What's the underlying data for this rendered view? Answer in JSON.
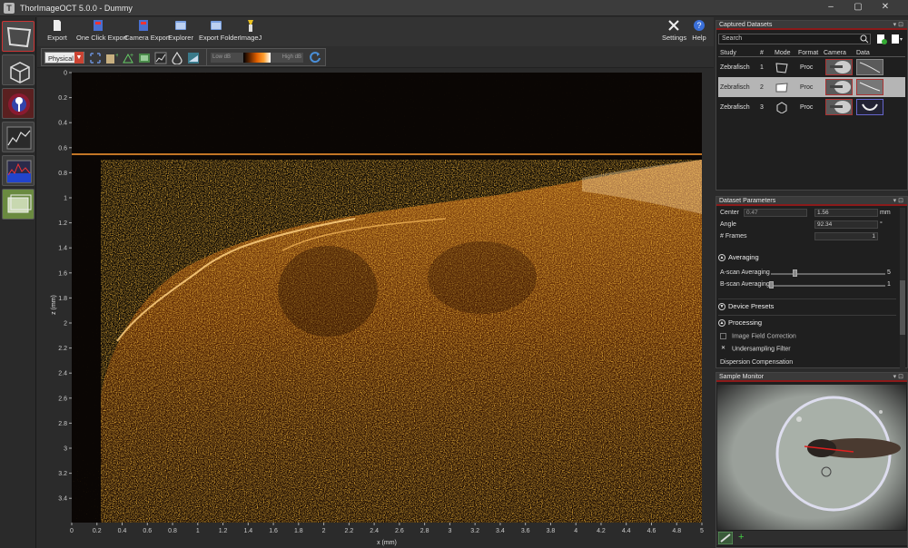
{
  "window": {
    "title": "ThorImageOCT 5.0.0 - Dummy",
    "app_icon_glyph": "T",
    "controls": [
      "–",
      "▢",
      "✕"
    ]
  },
  "toolbar": {
    "export_label": "Export",
    "one_click_export_label": "One Click Export",
    "camera_export_label": "Camera Export",
    "explorer_label": "Explorer",
    "export_folder_label": "Export Folder",
    "imagej_label": "ImageJ",
    "settings_label": "Settings",
    "help_label": "Help"
  },
  "view_toolbar": {
    "view_select_value": "Physical",
    "low_db_label": "Low dB",
    "high_db_label": "High dB"
  },
  "plot": {
    "xlabel": "x (mm)",
    "ylabel": "z (mm)",
    "x_ticks": [
      "0",
      "0.2",
      "0.4",
      "0.6",
      "0.8",
      "1",
      "1.2",
      "1.4",
      "1.6",
      "1.8",
      "2",
      "2.2",
      "2.4",
      "2.6",
      "2.8",
      "3",
      "3.2",
      "3.4",
      "3.6",
      "3.8",
      "4",
      "4.2",
      "4.4",
      "4.6",
      "4.8",
      "5"
    ],
    "y_ticks": [
      "0",
      "0.2",
      "0.4",
      "0.6",
      "0.8",
      "1",
      "1.2",
      "1.4",
      "1.6",
      "1.8",
      "2",
      "2.2",
      "2.4",
      "2.6",
      "2.8",
      "3",
      "3.2",
      "3.4"
    ],
    "colormap": [
      "#000000",
      "#6a2a00",
      "#e06000",
      "#ffa030",
      "#ffffff"
    ]
  },
  "captured_datasets": {
    "title": "Captured Datasets",
    "search_placeholder": "Search",
    "columns": [
      "Study",
      "#",
      "Mode",
      "Format",
      "Camera",
      "Data"
    ],
    "rows": [
      {
        "study": "Zebrafisch",
        "num": "1",
        "format": "Proc",
        "selected": false
      },
      {
        "study": "Zebrafisch",
        "num": "2",
        "format": "Proc",
        "selected": true
      },
      {
        "study": "Zebrafisch",
        "num": "3",
        "format": "Proc",
        "selected": false
      }
    ]
  },
  "dataset_parameters": {
    "title": "Dataset Parameters",
    "center_label": "Center",
    "center_value1": "0.47",
    "center_value2": "1.56",
    "center_unit": "mm",
    "angle_label": "Angle",
    "angle_value": "92.34",
    "angle_unit": "°",
    "frames_label": "# Frames",
    "frames_value": "1",
    "averaging_section": "Averaging",
    "ascan_label": "A-scan Averaging",
    "ascan_value": "5",
    "bscan_label": "B-scan Averaging",
    "bscan_value": "1",
    "device_presets_section": "Device Presets",
    "processing_section": "Processing",
    "image_field_correction_label": "Image Field Correction",
    "undersampling_filter_label": "Undersampling Filter",
    "dispersion_compensation_label": "Dispersion Compensation"
  },
  "sample_monitor": {
    "title": "Sample Monitor",
    "add_glyph": "+"
  }
}
